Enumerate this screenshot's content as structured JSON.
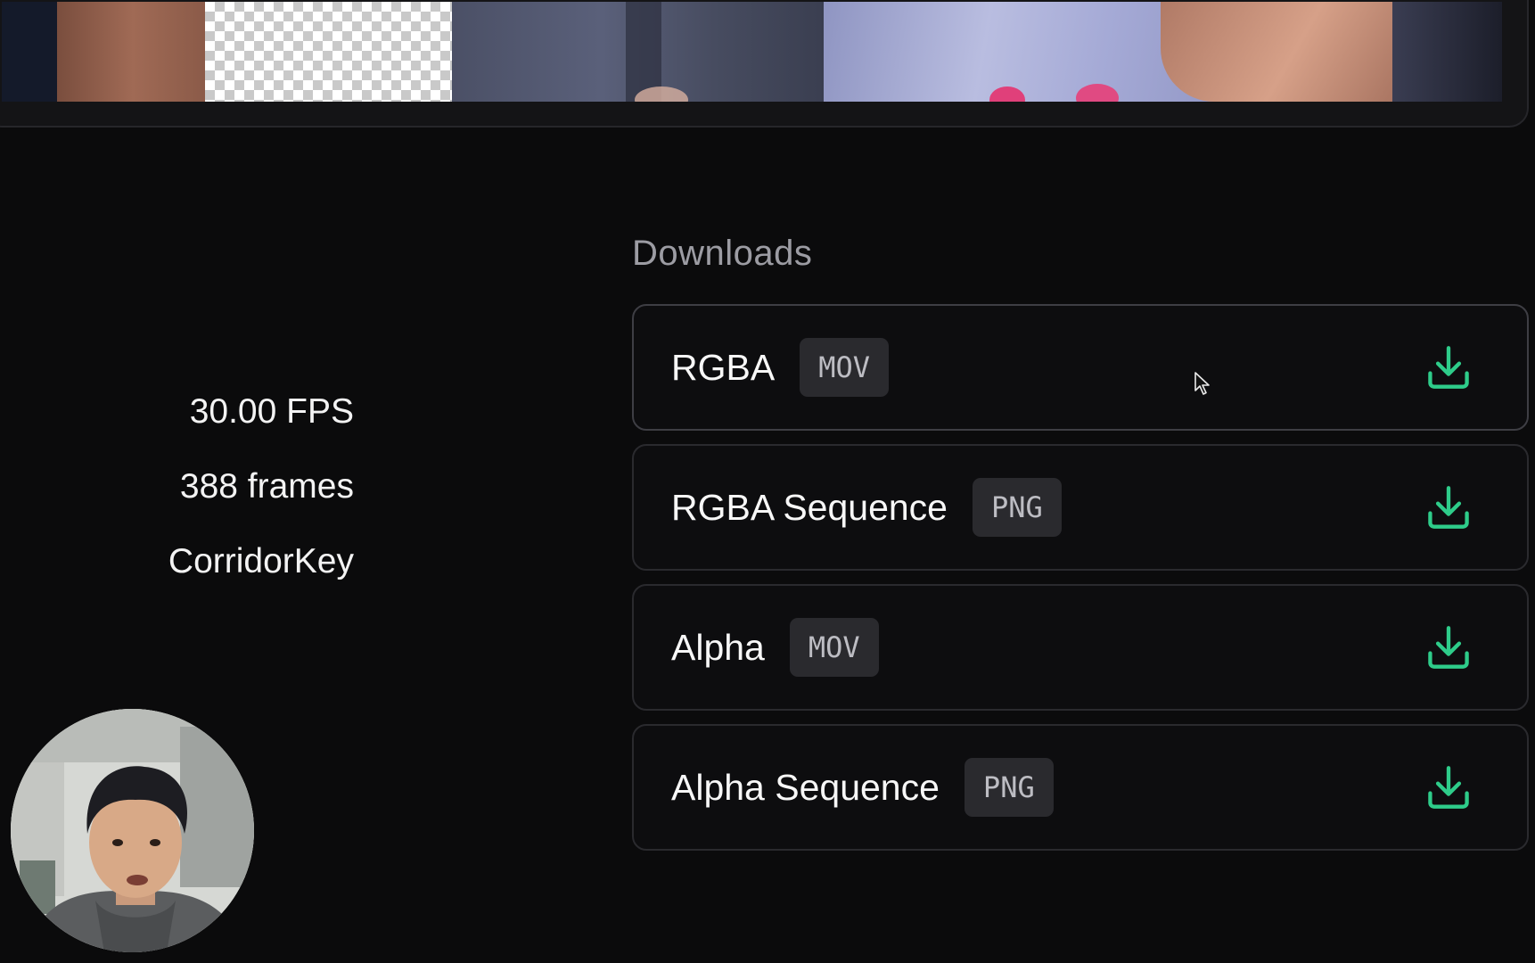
{
  "preview": {
    "label": "Video preview"
  },
  "stats": {
    "fps": "30.00 FPS",
    "frames": "388 frames",
    "model": "CorridorKey"
  },
  "downloads": {
    "heading": "Downloads",
    "items": [
      {
        "name": "RGBA",
        "format": "MOV"
      },
      {
        "name": "RGBA Sequence",
        "format": "PNG"
      },
      {
        "name": "Alpha",
        "format": "MOV"
      },
      {
        "name": "Alpha Sequence",
        "format": "PNG"
      }
    ]
  },
  "colors": {
    "background": "#0b0b0c",
    "card_border": "#2a2a2e",
    "badge_bg": "#2a2a2e",
    "download_icon": "#2ecc8a",
    "heading": "#9c9ca3"
  },
  "icons": {
    "download": "download-icon",
    "cursor": "mouse-pointer-icon"
  }
}
